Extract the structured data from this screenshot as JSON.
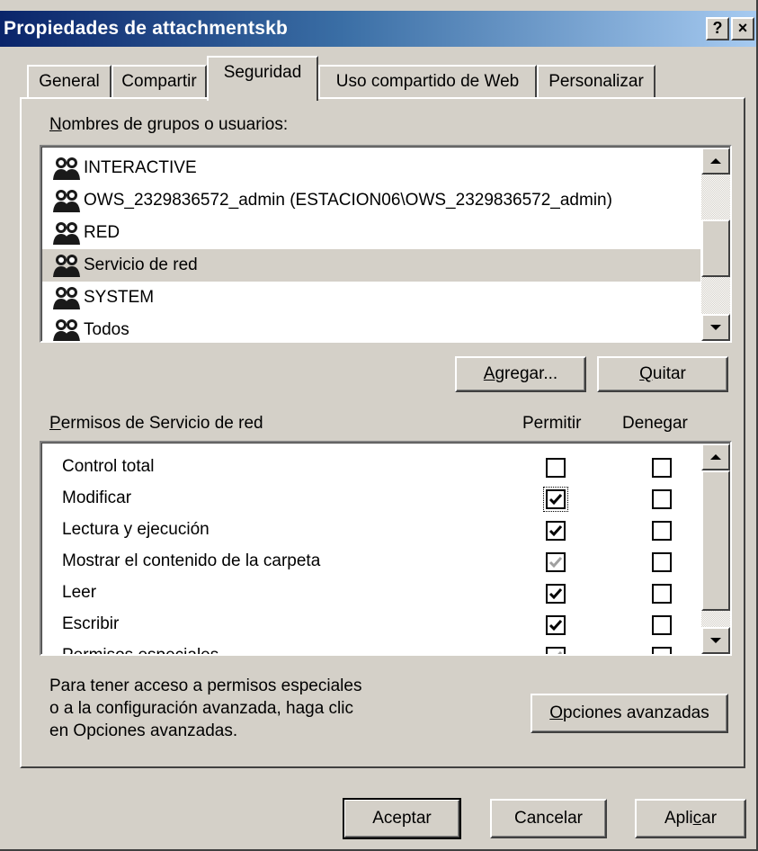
{
  "window": {
    "title": "Propiedades de attachmentskb",
    "help_glyph": "?",
    "close_glyph": "×"
  },
  "tabs": [
    {
      "label": "General",
      "active": false
    },
    {
      "label": "Compartir",
      "active": false
    },
    {
      "label": "Seguridad",
      "active": true
    },
    {
      "label": "Uso compartido de Web",
      "active": false
    },
    {
      "label": "Personalizar",
      "active": false
    }
  ],
  "groups": {
    "label_first": "N",
    "label_rest": "ombres de grupos o usuarios:",
    "icon": "users-group-icon",
    "items": [
      {
        "name": "INTERACTIVE",
        "selected": false
      },
      {
        "name": "OWS_2329836572_admin (ESTACION06\\OWS_2329836572_admin)",
        "selected": false
      },
      {
        "name": "RED",
        "selected": false
      },
      {
        "name": "Servicio de red",
        "selected": true
      },
      {
        "name": "SYSTEM",
        "selected": false
      },
      {
        "name": "Todos",
        "selected": false
      }
    ],
    "add_button": {
      "first": "A",
      "rest": "gregar..."
    },
    "remove_button": {
      "first": "Q",
      "rest": "uitar"
    }
  },
  "permissions": {
    "label_first": "P",
    "label_rest": "ermisos de Servicio de red",
    "allow_header": "Permitir",
    "deny_header": "Denegar",
    "rows": [
      {
        "name": "Control total",
        "allow": "unchecked",
        "deny": "unchecked"
      },
      {
        "name": "Modificar",
        "allow": "checked",
        "deny": "unchecked",
        "allow_focused": true
      },
      {
        "name": "Lectura y ejecución",
        "allow": "checked",
        "deny": "unchecked"
      },
      {
        "name": "Mostrar el contenido de la carpeta",
        "allow": "checked-disabled",
        "deny": "unchecked"
      },
      {
        "name": "Leer",
        "allow": "checked",
        "deny": "unchecked"
      },
      {
        "name": "Escribir",
        "allow": "checked",
        "deny": "unchecked"
      },
      {
        "name": "Permisos especiales",
        "allow": "checked-disabled",
        "deny": "unchecked"
      }
    ]
  },
  "advanced": {
    "description_lines": [
      "Para tener acceso a permisos especiales",
      "o a la configuración avanzada, haga clic",
      "en Opciones avanzadas."
    ],
    "button": {
      "first": "O",
      "rest": "pciones avanzadas"
    }
  },
  "footer": {
    "ok": "Aceptar",
    "cancel": "Cancelar",
    "apply_pre": "Apli",
    "apply_u": "c",
    "apply_post": "ar"
  },
  "colors": {
    "face": "#d4d0c8",
    "title_start": "#0a246a",
    "title_end": "#a6caf0",
    "check_disabled": "#a0a0a0"
  }
}
